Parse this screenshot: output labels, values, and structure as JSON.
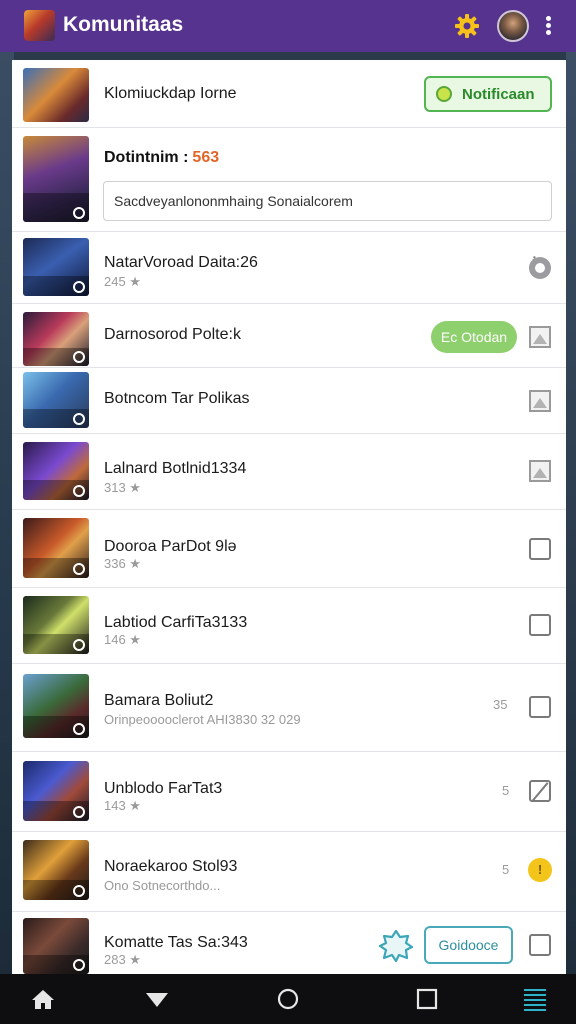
{
  "app": {
    "title": "Komunitaas"
  },
  "topbar": {
    "gear_icon": "gear-icon",
    "avatar_icon": "avatar",
    "menu_icon": "kebab-icon"
  },
  "colors": {
    "header": "#55338e",
    "accent_green": "#52b552",
    "pill_green": "#8fd06e",
    "teal": "#49a9b8",
    "orange": "#e2662a"
  },
  "header_row": {
    "title": "Klomiuckdap Iorne",
    "notify_label": "Notificaan"
  },
  "post_row": {
    "title": "Dotintnim :",
    "count": "563",
    "input_value": "Sacdveyanlononmhaing Sonaialcorem",
    "input_suffix": "ℹ"
  },
  "items": [
    {
      "title": "NatarVoroad Daita:26",
      "sub": "245 ★",
      "meta": "",
      "control": "circle",
      "control_text": ""
    },
    {
      "title": "Darnosorod Polte:k",
      "sub": "",
      "meta": "",
      "control": "triangle",
      "control_text": "",
      "pill": "Ec Otodan"
    },
    {
      "title": "Botncom Tar Polikas",
      "sub": "",
      "meta": "",
      "control": "triangle",
      "control_text": ""
    },
    {
      "title": "Lalnard Botlnid1334",
      "sub": "313 ★",
      "meta": "",
      "control": "triangle",
      "control_text": ""
    },
    {
      "title": "Dooroa ParDot 9lə",
      "sub": "336 ★",
      "meta": "",
      "control": "checkbox",
      "control_text": ""
    },
    {
      "title": "Labtiod CarfiTa3133",
      "sub": "146 ★",
      "meta": "",
      "control": "checkbox",
      "control_text": ""
    },
    {
      "title": "Bamara Boliut2",
      "sub": "Orinpeooooclerot AHI3830 32 029",
      "meta": "35",
      "control": "checkbox",
      "control_text": ""
    },
    {
      "title": "Unblodo FarTat3",
      "sub": "143 ★",
      "meta": "5",
      "control": "slash",
      "control_text": ""
    },
    {
      "title": "Noraekaroo Stol93",
      "sub": "Ono Sotnecorthdo...",
      "meta": "5",
      "control": "yellow",
      "control_text": "!"
    },
    {
      "title": "Komatte Tas Sa:343",
      "sub": "283 ★",
      "meta": "",
      "control": "checkbox",
      "control_text": "",
      "button": "Goidooce"
    }
  ],
  "navbar": [
    "home-icon",
    "back-icon",
    "circle-home-icon",
    "square-recents-icon",
    "menu-lines-icon"
  ]
}
